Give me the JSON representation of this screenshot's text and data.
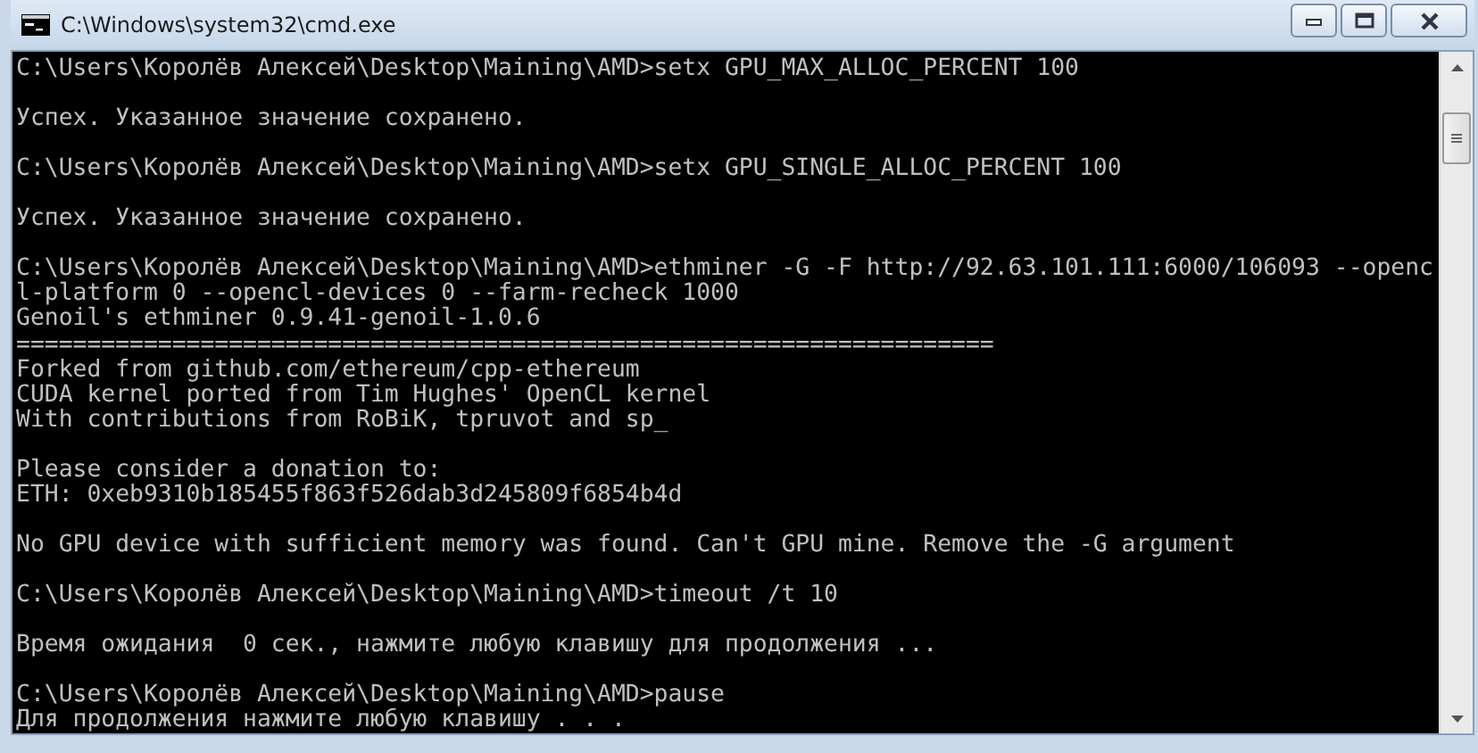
{
  "window": {
    "title": "C:\\Windows\\system32\\cmd.exe"
  },
  "console": {
    "blocks": [
      [
        "C:\\Users\\Королёв Алексей\\Desktop\\Maining\\AMD>setx GPU_MAX_ALLOC_PERCENT 100"
      ],
      [
        "Успех. Указанное значение сохранено."
      ],
      [
        "C:\\Users\\Королёв Алексей\\Desktop\\Maining\\AMD>setx GPU_SINGLE_ALLOC_PERCENT 100"
      ],
      [
        "Успех. Указанное значение сохранено."
      ],
      [
        "C:\\Users\\Королёв Алексей\\Desktop\\Maining\\AMD>ethminer -G -F http://92.63.101.111:6000/106093 --openc",
        "l-platform 0 --opencl-devices 0 --farm-recheck 1000",
        "Genoil's ethminer 0.9.41-genoil-1.0.6",
        "=====================================================================",
        "Forked from github.com/ethereum/cpp-ethereum",
        "CUDA kernel ported from Tim Hughes' OpenCL kernel",
        "With contributions from RoBiK, tpruvot and sp_"
      ],
      [
        "Please consider a donation to:",
        "ETH: 0xeb9310b185455f863f526dab3d245809f6854b4d"
      ],
      [
        "No GPU device with sufficient memory was found. Can't GPU mine. Remove the -G argument"
      ],
      [
        "C:\\Users\\Королёв Алексей\\Desktop\\Maining\\AMD>timeout /t 10"
      ],
      [
        "Время ожидания  0 сек., нажмите любую клавишу для продолжения ..."
      ],
      [
        "C:\\Users\\Королёв Алексей\\Desktop\\Maining\\AMD>pause",
        "Для продолжения нажмите любую клавишу . . ."
      ]
    ]
  }
}
